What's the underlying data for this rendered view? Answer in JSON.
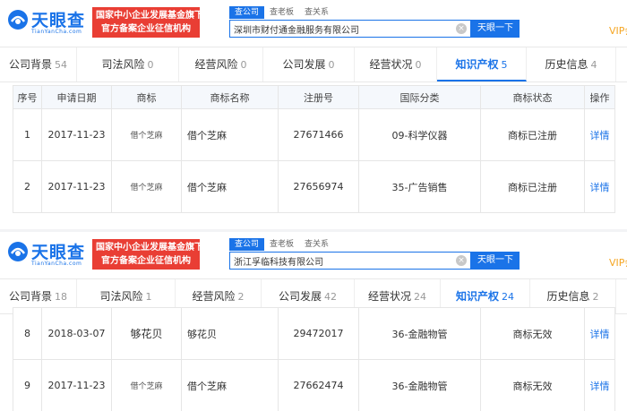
{
  "brand": {
    "logo_text": "天眼查",
    "logo_sub": "TianYanCha.com",
    "banner_line1": "国家中小企业发展基金旗下",
    "banner_line2": "官方备案企业征信机构"
  },
  "colors": {
    "accent": "#1a73e8",
    "banner": "#e93e34",
    "vip": "#f5a623"
  },
  "search_tabs": [
    "查公司",
    "查老板",
    "查关系"
  ],
  "search_button": "天眼一下",
  "vip_label": "VIP会",
  "panels": [
    {
      "search_value": "深圳市财付通金融服务有限公司",
      "tabs": [
        {
          "label": "公司背景",
          "count": "54"
        },
        {
          "label": "司法风险",
          "count": "0"
        },
        {
          "label": "经营风险",
          "count": "0"
        },
        {
          "label": "公司发展",
          "count": "0"
        },
        {
          "label": "经营状况",
          "count": "0"
        },
        {
          "label": "知识产权",
          "count": "5"
        },
        {
          "label": "历史信息",
          "count": "4"
        }
      ],
      "headers": [
        "序号",
        "申请日期",
        "商标",
        "商标名称",
        "注册号",
        "国际分类",
        "商标状态",
        "操作"
      ],
      "rows": [
        {
          "no": "1",
          "date": "2017-11-23",
          "mark": "借个芝麻",
          "name": "借个芝麻",
          "reg": "27671466",
          "class": "09-科学仪器",
          "status": "商标已注册",
          "action": "详情"
        },
        {
          "no": "2",
          "date": "2017-11-23",
          "mark": "借个芝麻",
          "name": "借个芝麻",
          "reg": "27656974",
          "class": "35-广告销售",
          "status": "商标已注册",
          "action": "详情"
        }
      ]
    },
    {
      "search_value": "浙江孚临科技有限公司",
      "tabs": [
        {
          "label": "公司背景",
          "count": "18"
        },
        {
          "label": "司法风险",
          "count": "1"
        },
        {
          "label": "经营风险",
          "count": "2"
        },
        {
          "label": "公司发展",
          "count": "42"
        },
        {
          "label": "经营状况",
          "count": "24"
        },
        {
          "label": "知识产权",
          "count": "24"
        },
        {
          "label": "历史信息",
          "count": "2"
        }
      ],
      "rows": [
        {
          "no": "8",
          "date": "2018-03-07",
          "mark": "够花贝",
          "name": "够花贝",
          "reg": "29472017",
          "class": "36-金融物管",
          "status": "商标无效",
          "action": "详情"
        },
        {
          "no": "9",
          "date": "2017-11-23",
          "mark": "借个芝麻",
          "name": "借个芝麻",
          "reg": "27662474",
          "class": "36-金融物管",
          "status": "商标无效",
          "action": "详情"
        }
      ]
    }
  ]
}
